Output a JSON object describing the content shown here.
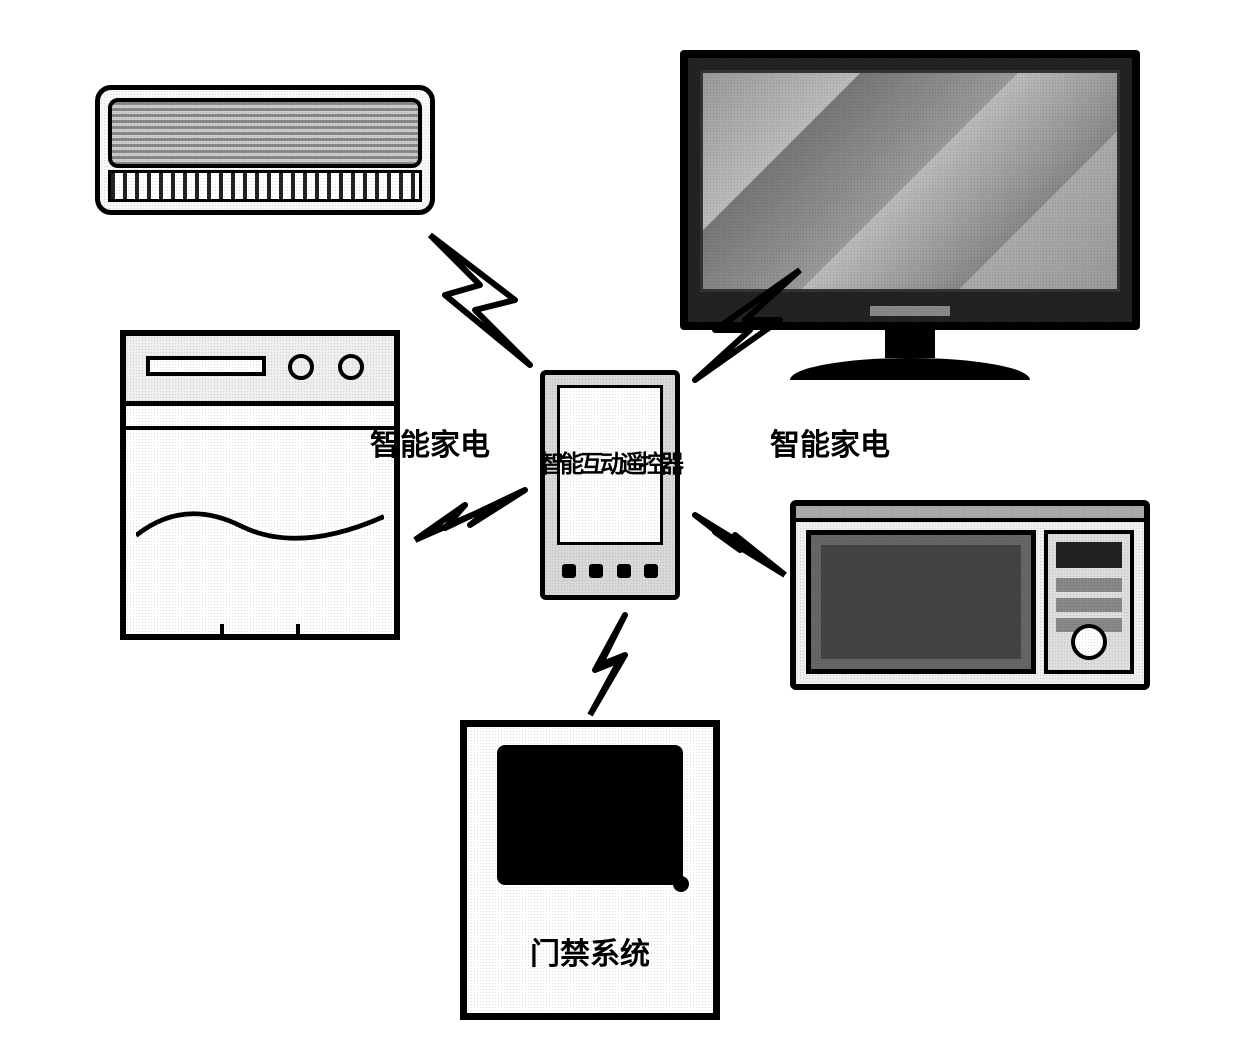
{
  "center": {
    "remote_label": "智能互动遥控器"
  },
  "labels": {
    "left_group": "智能家电",
    "right_group": "智能家电",
    "door": "门禁系统"
  },
  "devices": {
    "air_conditioner": "air-conditioner",
    "dishwasher": "dishwasher",
    "television": "television",
    "microwave": "microwave-oven",
    "door_access": "door-access-system"
  },
  "icons": {
    "signal": "wireless-signal-bolt"
  }
}
